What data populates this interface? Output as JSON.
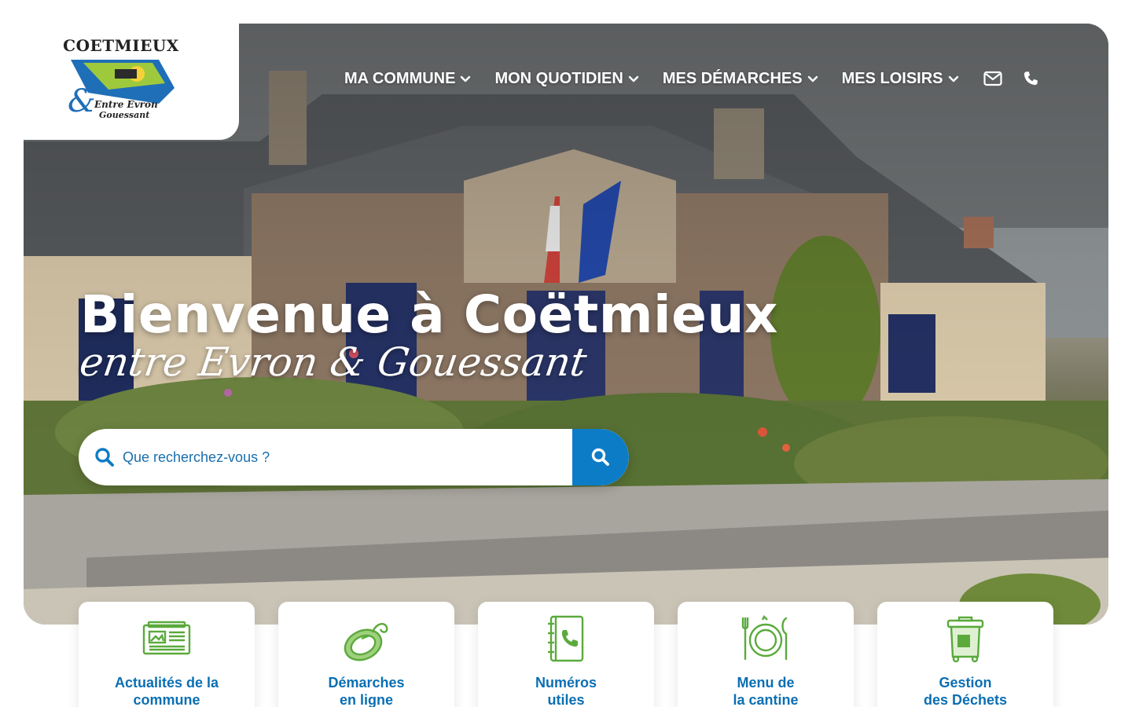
{
  "logo": {
    "title": "COETMIEUX",
    "tagline_line1": "Entre Evron",
    "tagline_line2": "Gouessant"
  },
  "nav": {
    "items": [
      {
        "label": "MA COMMUNE",
        "icon": "chevron-down-icon"
      },
      {
        "label": "MON QUOTIDIEN",
        "icon": "chevron-down-icon"
      },
      {
        "label": "MES DÉMARCHES",
        "icon": "chevron-down-icon"
      },
      {
        "label": "MES LOISIRS",
        "icon": "chevron-down-icon"
      }
    ],
    "contact_icons": [
      "mail-icon",
      "phone-icon"
    ]
  },
  "hero": {
    "headline": "Bienvenue à Coëtmieux",
    "subline": "entre Evron & Gouessant"
  },
  "search": {
    "placeholder": "Que recherchez-vous ?",
    "value": "",
    "icon": "search-icon",
    "button_icon": "search-icon"
  },
  "cards": [
    {
      "line1": "Actualités de la",
      "line2": "commune",
      "icon": "newspaper-icon"
    },
    {
      "line1": "Démarches",
      "line2": "en ligne",
      "icon": "computer-mouse-icon"
    },
    {
      "line1": "Numéros",
      "line2": "utiles",
      "icon": "phone-book-icon"
    },
    {
      "line1": "Menu de",
      "line2": "la cantine",
      "icon": "plate-cutlery-icon"
    },
    {
      "line1": "Gestion",
      "line2": "des Déchets",
      "icon": "waste-bin-icon"
    }
  ],
  "colors": {
    "brand_blue": "#0d7cc6",
    "text_blue": "#0b6fb3",
    "icon_green": "#5aaa3c",
    "white": "#ffffff"
  }
}
